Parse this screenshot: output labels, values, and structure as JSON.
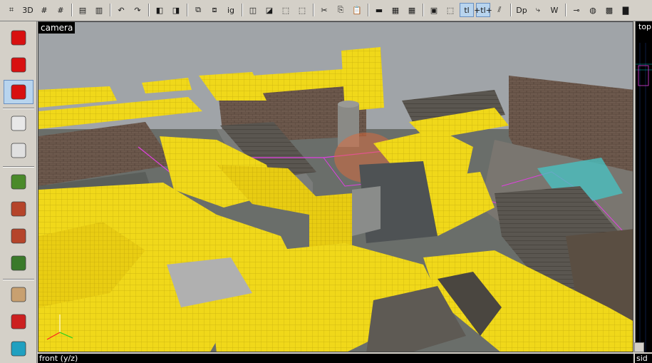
{
  "toolbar": {
    "tools": [
      {
        "name": "grid-toggle-icon",
        "glyph": "⌗"
      },
      {
        "name": "3d-grid-icon",
        "glyph": "3D"
      },
      {
        "name": "grid-smaller-icon",
        "glyph": "#"
      },
      {
        "name": "grid-larger-icon",
        "glyph": "#"
      },
      {
        "name": "group-icon",
        "glyph": "▤"
      },
      {
        "name": "ungroup-icon",
        "glyph": "▥"
      },
      {
        "name": "undo-icon",
        "glyph": "↶"
      },
      {
        "name": "redo-icon",
        "glyph": "↷"
      },
      {
        "name": "carve-icon",
        "glyph": "◧"
      },
      {
        "name": "hollow-icon",
        "glyph": "◨"
      },
      {
        "name": "tie-to-entity-icon",
        "glyph": "⧉"
      },
      {
        "name": "move-to-world-icon",
        "glyph": "⧈"
      },
      {
        "name": "ignore-group-icon",
        "glyph": "ig"
      },
      {
        "name": "cordon-icon",
        "glyph": "◫"
      },
      {
        "name": "cordon-edit-icon",
        "glyph": "◪"
      },
      {
        "name": "cordon-toggle-icon",
        "glyph": "⬚"
      },
      {
        "name": "cordon-new-icon",
        "glyph": "⬚"
      },
      {
        "name": "cut-icon",
        "glyph": "✂"
      },
      {
        "name": "copy-icon",
        "glyph": "⎘"
      },
      {
        "name": "paste-icon",
        "glyph": "📋"
      },
      {
        "name": "texture-lock-icon",
        "glyph": "▬"
      },
      {
        "name": "hide-objects-icon",
        "glyph": "▦"
      },
      {
        "name": "show-objects-icon",
        "glyph": "▦"
      },
      {
        "name": "selection-icon",
        "glyph": "▣"
      },
      {
        "name": "select-mode-icon",
        "glyph": "⬚"
      },
      {
        "name": "texture-lock-toggle-icon",
        "glyph": "tl"
      },
      {
        "name": "texture-scale-lock-icon",
        "glyph": "+tl+"
      },
      {
        "name": "radius-culling-icon",
        "glyph": "⫽"
      },
      {
        "name": "show-displacement-icon",
        "glyph": "Dp"
      },
      {
        "name": "helpers-icon",
        "glyph": "⤷"
      },
      {
        "name": "world-icon",
        "glyph": "W"
      },
      {
        "name": "entity-report-icon",
        "glyph": "⊸"
      },
      {
        "name": "globe-icon",
        "glyph": "◍"
      },
      {
        "name": "overlay-icon",
        "glyph": "▩"
      },
      {
        "name": "color-icon",
        "glyph": "▇"
      }
    ],
    "active": [
      25,
      26
    ]
  },
  "left_tools": [
    {
      "name": "selection-tool-icon",
      "color": "#d81010"
    },
    {
      "name": "magnify-tool-icon",
      "color": "#d81010"
    },
    {
      "name": "camera-tool-icon",
      "color": "#d81010"
    },
    {
      "name": "entity-tool-icon",
      "color": "#e8e8e8"
    },
    {
      "name": "block-tool-icon",
      "color": "#e0e0e0"
    },
    {
      "name": "texture-application-icon",
      "color": "#4a8a2a"
    },
    {
      "name": "apply-current-texture-icon",
      "color": "#b5442a"
    },
    {
      "name": "decal-tool-icon",
      "color": "#b5442a"
    },
    {
      "name": "overlay-tool-icon",
      "color": "#3a7a2a"
    },
    {
      "name": "clipping-tool-icon",
      "color": "#c8a070"
    },
    {
      "name": "vertex-tool-icon",
      "color": "#cc2020"
    },
    {
      "name": "path-tool-icon",
      "color": "#20a0c0"
    }
  ],
  "viewports": {
    "camera_label": "camera",
    "top_label": "top",
    "front_label": "front (y/z)",
    "side_label": "sid"
  },
  "colors": {
    "nodraw_yellow": "#f0d81a",
    "sky_grey": "#a0a4a8",
    "selection_magenta": "#e040e0",
    "background_black": "#000000"
  }
}
